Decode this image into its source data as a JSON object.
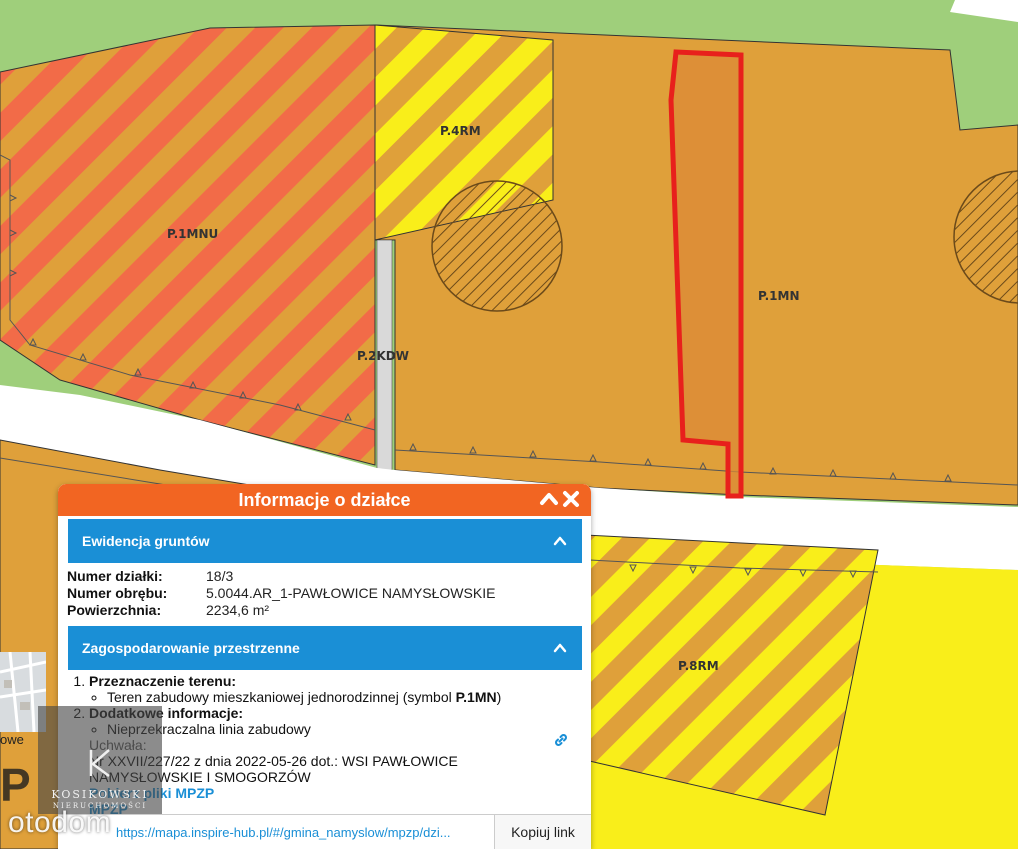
{
  "map": {
    "zones": {
      "p1mnu": "P.1MNU",
      "p4rm": "P.4RM",
      "p2kdw": "P.2KDW",
      "p1mn": "P.1MN",
      "p8rm": "P.8RM"
    },
    "colors": {
      "green": "#9fcf7b",
      "orange_zone": "#dfa03a",
      "red_stripe": "#f26b48",
      "yellow": "#f9ee1a",
      "road": "#ffffff",
      "parcel_outline": "#e8201c"
    }
  },
  "panel": {
    "title": "Informacje o działce",
    "section1": "Ewidencja gruntów",
    "rows": [
      {
        "label": "Numer działki:",
        "value": "18/3"
      },
      {
        "label": "Numer obrębu:",
        "value": "5.0044.AR_1-PAWŁOWICE NAMYSŁOWSKIE"
      },
      {
        "label": "Powierzchnia:",
        "value": "2234,6 m²"
      }
    ],
    "section2": "Zagospodarowanie przestrzenne",
    "item1_title": "Przeznaczenie terenu:",
    "item1_bullet_prefix": "Teren zabudowy mieszkaniowej jednorodzinnej (symbol ",
    "item1_symbol": "P.1MN",
    "item1_suffix": ")",
    "item2_title": "Dodatkowe informacje:",
    "item2_bullet": "Nieprzekraczalna linia zabudowy",
    "uchwala": "Uchwała:",
    "uchwala_line1": "Nr XXVII/227/22 z dnia 2022-05-26 dot.: WSI PAWŁOWICE",
    "uchwala_line2": "NAMYSŁOWSKIE I SMOGORZÓW",
    "mpzp1": "Pobierz pliki MPZP",
    "mpzp2": "MPZP",
    "link": "https://mapa.inspire-hub.pl/#/gmina_namyslow/mpzp/dzi...",
    "copy_label": "Kopiuj link"
  },
  "overlay": {
    "thumb_label": "owe",
    "p_letter": "P",
    "kos_name": "KOSIKOWSKI",
    "kos_sub": "NIERUCHOMOŚCI",
    "otodom": "otodom"
  }
}
